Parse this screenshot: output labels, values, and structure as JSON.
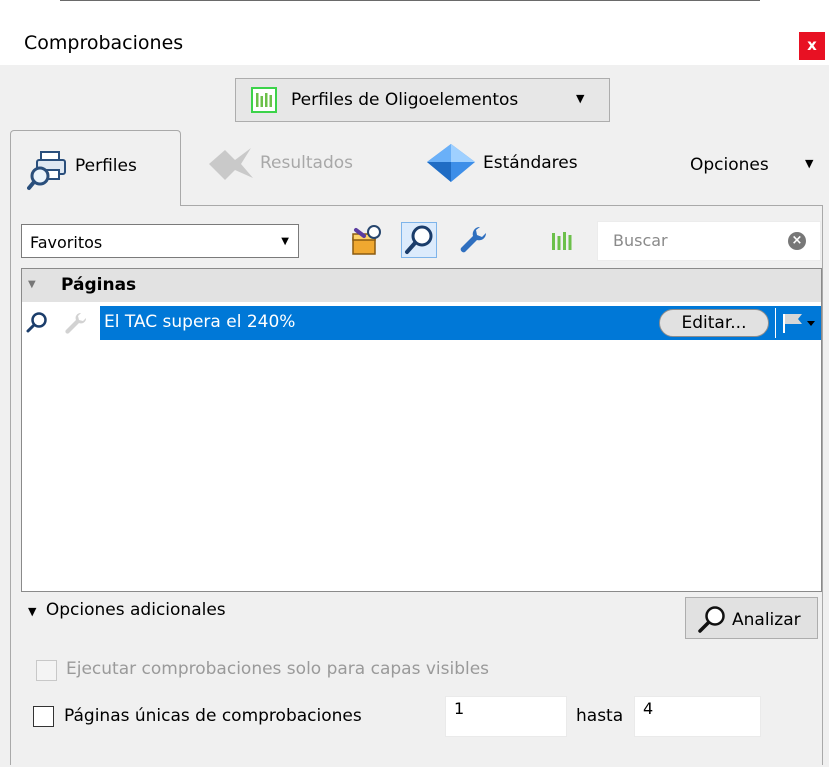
{
  "window": {
    "title": "Comprobaciones",
    "close_label": "x"
  },
  "profile_dropdown": {
    "label": "Perfiles de Oligoelementos",
    "icon": "green-bars-icon"
  },
  "tabs": [
    {
      "label": "Perfiles",
      "icon": "printer-magnifier-icon",
      "state": "active"
    },
    {
      "label": "Resultados",
      "icon": "arrows-icon",
      "state": "disabled"
    },
    {
      "label": "Estándares",
      "icon": "diamond-icon",
      "state": "normal"
    }
  ],
  "options_menu": {
    "label": "Opciones"
  },
  "filter": {
    "selected": "Favoritos"
  },
  "toolbar": {
    "icons": [
      "fixups-icon",
      "checks-icon",
      "wrench-icon",
      "green-bars-icon"
    ],
    "selected": "checks-icon"
  },
  "search": {
    "placeholder": "Buscar",
    "value": ""
  },
  "list": {
    "group_label": "Páginas",
    "rows": [
      {
        "label": "El TAC supera el 240%",
        "edit_label": "Editar...",
        "selected": true
      }
    ]
  },
  "additional_options": {
    "toggle_label": "Opciones adicionales",
    "analyze_label": "Analizar",
    "visible_layers": {
      "label": "Ejecutar comprobaciones solo para capas visibles",
      "checked": false,
      "enabled": false
    },
    "page_range": {
      "label": "Páginas únicas de comprobaciones",
      "checked": false,
      "from": "1",
      "to_label": "hasta",
      "to": "4"
    }
  },
  "colors": {
    "selection": "#0078d7",
    "close": "#e81123",
    "profile_icon": "#3cd34a"
  }
}
